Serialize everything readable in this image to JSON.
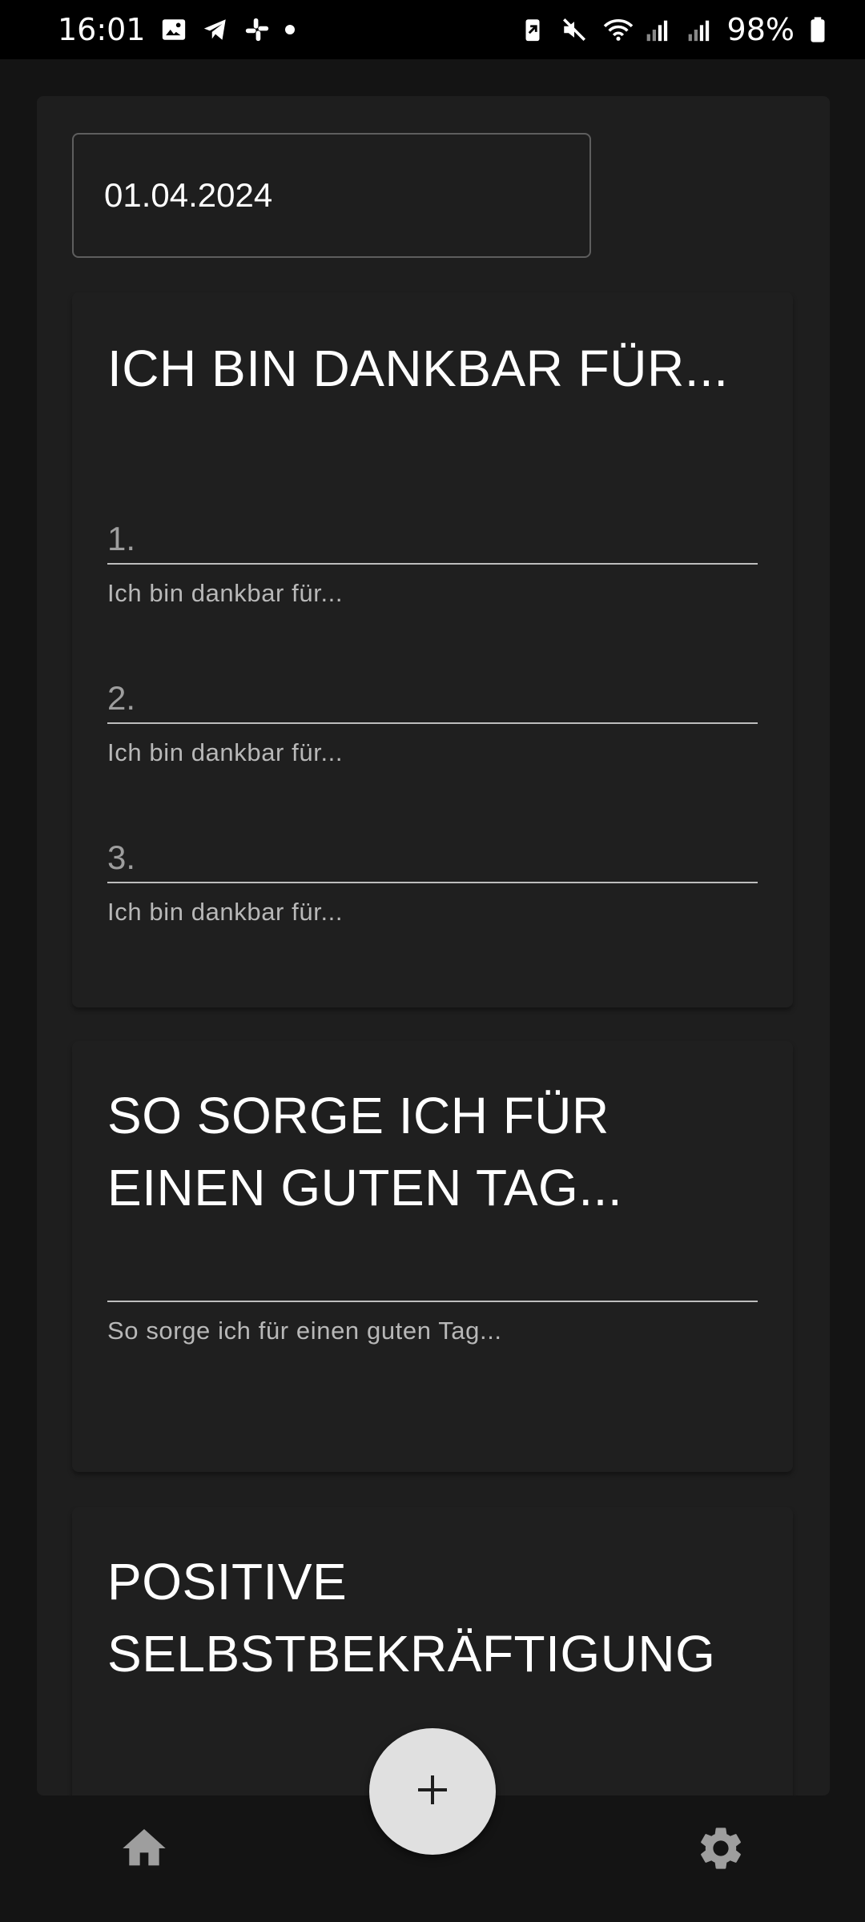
{
  "status_bar": {
    "time": "16:01",
    "battery_percent": "98%",
    "icons_left": [
      "gallery-icon",
      "telegram-icon",
      "slack-icon",
      "dot-icon"
    ],
    "icons_right": [
      "battery-saver-icon",
      "mute-icon",
      "wifi-icon",
      "signal-icon",
      "signal-icon",
      "battery-icon"
    ]
  },
  "date_field": {
    "value": "01.04.2024"
  },
  "gratitude_card": {
    "title": "ICH BIN DANKBAR FÜR...",
    "entries": [
      {
        "number": "1.",
        "hint": "Ich bin dankbar für..."
      },
      {
        "number": "2.",
        "hint": "Ich bin dankbar für..."
      },
      {
        "number": "3.",
        "hint": "Ich bin dankbar für..."
      }
    ]
  },
  "good_day_card": {
    "title": "SO SORGE ICH FÜR EINEN GUTEN TAG...",
    "hint": "So sorge ich für einen guten Tag..."
  },
  "affirmation_card": {
    "title": "POSITIVE SELBSTBEKRÄFTIGUNG"
  },
  "bottom_nav": {
    "home_icon": "home-icon",
    "add_icon": "plus-icon",
    "settings_icon": "gear-icon"
  },
  "colors": {
    "background": "#141414",
    "surface": "#1e1e1e",
    "fab": "#e0e0e0"
  }
}
